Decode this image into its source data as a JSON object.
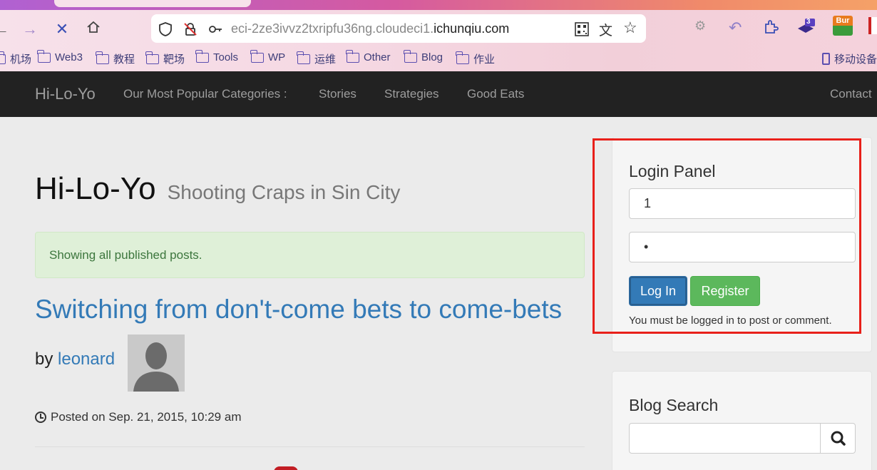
{
  "browser": {
    "url_prefix": "eci-2ze3ivvz2txripfu36ng.cloudeci1.",
    "url_domain": "ichunqiu.com",
    "extension_badge": "3",
    "burp_label": "Bur",
    "bookmarks": [
      "机场",
      "Web3",
      "教程",
      "靶场",
      "Tools",
      "WP",
      "运维",
      "Other",
      "Blog",
      "作业"
    ],
    "mobile_label": "移动设备"
  },
  "navbar": {
    "brand": "Hi-Lo-Yo",
    "links": [
      "Our Most Popular Categories :",
      "Stories",
      "Strategies",
      "Good Eats",
      "Contact"
    ]
  },
  "main": {
    "title": "Hi-Lo-Yo",
    "subtitle": "Shooting Craps in Sin City",
    "alert": "Showing all published posts.",
    "post_title": "Switching from don't-come bets to come-bets",
    "by_label": "by",
    "author": "leonard",
    "posted": "Posted on Sep. 21, 2015, 10:29 am"
  },
  "login_panel": {
    "title": "Login Panel",
    "username_value": "1",
    "password_value": "•",
    "login_label": "Log In",
    "register_label": "Register",
    "note": "You must be logged in to post or comment."
  },
  "search_panel": {
    "title": "Blog Search",
    "value": ""
  },
  "colors": {
    "navbar_bg": "#222222",
    "link": "#337ab7",
    "primary": "#337ab7",
    "success": "#5cb85c",
    "highlight": "#e8201a"
  }
}
